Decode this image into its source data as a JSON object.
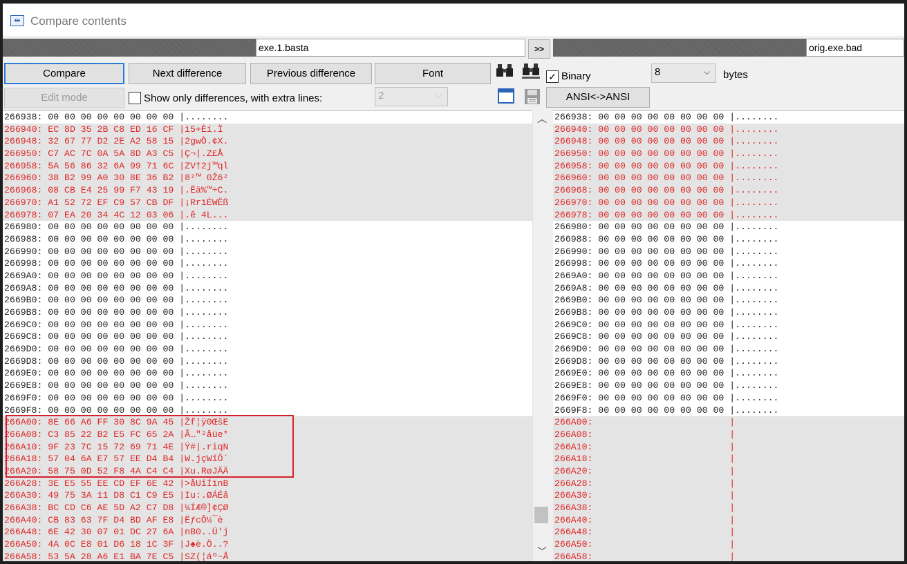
{
  "window": {
    "title": "Compare contents",
    "icon": "compare-icon"
  },
  "files": {
    "left": "exe.1.basta",
    "swap_label": ">>",
    "right": "orig.exe.bad"
  },
  "toolbar": {
    "compare": "Compare",
    "next_diff": "Next difference",
    "prev_diff": "Previous difference",
    "font": "Font",
    "binary_checkbox_mark": "✓",
    "binary_label": "Binary",
    "bytes_value": "8",
    "bytes_label": "bytes",
    "edit_mode": "Edit mode",
    "show_only_label": "Show only differences, with extra lines:",
    "extra_lines_value": "2",
    "ansi": "ANSI<->ANSI",
    "find_icon": "binoculars-icon",
    "find_next_icon": "binoculars-next-icon",
    "window_icon": "window-icon",
    "save_icon": "save-icon"
  },
  "colors": {
    "diff_text": "#e02626",
    "diff_bg": "#e4e4e4",
    "highlight_box": "#d51f2b"
  },
  "left_pane": {
    "rows": [
      {
        "t": "266938: 00 00 00 00 00 00 00 00 |........",
        "d": false
      },
      {
        "t": "266940: EC 8D 35 2B C8 ED 16 CF |ì5+Èí.Ï",
        "d": true
      },
      {
        "t": "266948: 32 67 77 D2 2E A2 58 15 |2gwÒ.¢X.",
        "d": true
      },
      {
        "t": "266950: C7 AC 7C 0A 5A 8D A3 C5 |Ç¬|.Z£Å",
        "d": true
      },
      {
        "t": "266958: 5A 56 86 32 6A 99 71 6C |ZV†2j™ql",
        "d": true
      },
      {
        "t": "266960: 38 B2 99 A0 30 8E 36 B2 |8²™ 0Ž6²",
        "d": true
      },
      {
        "t": "266968: 08 CB E4 25 99 F7 43 19 |.Ëä%™÷C.",
        "d": true
      },
      {
        "t": "266970: A1 52 72 EF C9 57 CB DF |¡RrïÉWËß",
        "d": true
      },
      {
        "t": "266978: 07 EA 20 34 4C 12 03 06 |.ê 4L...",
        "d": true
      },
      {
        "t": "266980: 00 00 00 00 00 00 00 00 |........",
        "d": false
      },
      {
        "t": "266988: 00 00 00 00 00 00 00 00 |........",
        "d": false
      },
      {
        "t": "266990: 00 00 00 00 00 00 00 00 |........",
        "d": false
      },
      {
        "t": "266998: 00 00 00 00 00 00 00 00 |........",
        "d": false
      },
      {
        "t": "2669A0: 00 00 00 00 00 00 00 00 |........",
        "d": false
      },
      {
        "t": "2669A8: 00 00 00 00 00 00 00 00 |........",
        "d": false
      },
      {
        "t": "2669B0: 00 00 00 00 00 00 00 00 |........",
        "d": false
      },
      {
        "t": "2669B8: 00 00 00 00 00 00 00 00 |........",
        "d": false
      },
      {
        "t": "2669C0: 00 00 00 00 00 00 00 00 |........",
        "d": false
      },
      {
        "t": "2669C8: 00 00 00 00 00 00 00 00 |........",
        "d": false
      },
      {
        "t": "2669D0: 00 00 00 00 00 00 00 00 |........",
        "d": false
      },
      {
        "t": "2669D8: 00 00 00 00 00 00 00 00 |........",
        "d": false
      },
      {
        "t": "2669E0: 00 00 00 00 00 00 00 00 |........",
        "d": false
      },
      {
        "t": "2669E8: 00 00 00 00 00 00 00 00 |........",
        "d": false
      },
      {
        "t": "2669F0: 00 00 00 00 00 00 00 00 |........",
        "d": false
      },
      {
        "t": "2669F8: 00 00 00 00 00 00 00 00 |........",
        "d": false
      },
      {
        "t": "266A00: 8E 66 A6 FF 30 8C 9A 45 |Žf¦ÿ0ŒšE",
        "d": true
      },
      {
        "t": "266A08: C3 85 22 B2 E5 FC 65 2A |Ã…\"²åüe*",
        "d": true
      },
      {
        "t": "266A10: 9F 23 7C 15 72 69 71 4E |Ÿ#|.riqN",
        "d": true
      },
      {
        "t": "266A18: 57 04 6A E7 57 EE D4 B4 |W.jçWîÔ´",
        "d": true
      },
      {
        "t": "266A20: 58 75 0D 52 F8 4A C4 C4 |Xu.RøJÄÄ",
        "d": true
      },
      {
        "t": "266A28: 3E E5 55 EE CD EF 6E 42 |>åUîÍïnB",
        "d": true
      },
      {
        "t": "266A30: 49 75 3A 11 D8 C1 C9 E5 |Iu:.ØÁÉå",
        "d": true
      },
      {
        "t": "266A38: BC CD C6 AE 5D A2 C7 D8 |¼ÍÆ®]¢ÇØ",
        "d": true
      },
      {
        "t": "266A40: CB 83 63 7F D4 BD AF E8 |ËƒcÔ½¯è",
        "d": true
      },
      {
        "t": "266A48: 6E 42 30 07 01 DC 27 6A |nB0..Ü'j",
        "d": true
      },
      {
        "t": "266A50: 4A 0C E8 01 D6 18 1C 3F |J♠è.Ö..?",
        "d": true
      },
      {
        "t": "266A58: 53 5A 28 A6 E1 BA 7E C5 |SZ(¦áº~Å",
        "d": true
      }
    ]
  },
  "right_pane": {
    "rows": [
      {
        "t": "266938: 00 00 00 00 00 00 00 00 |........",
        "d": false
      },
      {
        "t": "266940: 00 00 00 00 00 00 00 00 |........",
        "d": true
      },
      {
        "t": "266948: 00 00 00 00 00 00 00 00 |........",
        "d": true
      },
      {
        "t": "266950: 00 00 00 00 00 00 00 00 |........",
        "d": true
      },
      {
        "t": "266958: 00 00 00 00 00 00 00 00 |........",
        "d": true
      },
      {
        "t": "266960: 00 00 00 00 00 00 00 00 |........",
        "d": true
      },
      {
        "t": "266968: 00 00 00 00 00 00 00 00 |........",
        "d": true
      },
      {
        "t": "266970: 00 00 00 00 00 00 00 00 |........",
        "d": true
      },
      {
        "t": "266978: 00 00 00 00 00 00 00 00 |........",
        "d": true
      },
      {
        "t": "266980: 00 00 00 00 00 00 00 00 |........",
        "d": false
      },
      {
        "t": "266988: 00 00 00 00 00 00 00 00 |........",
        "d": false
      },
      {
        "t": "266990: 00 00 00 00 00 00 00 00 |........",
        "d": false
      },
      {
        "t": "266998: 00 00 00 00 00 00 00 00 |........",
        "d": false
      },
      {
        "t": "2669A0: 00 00 00 00 00 00 00 00 |........",
        "d": false
      },
      {
        "t": "2669A8: 00 00 00 00 00 00 00 00 |........",
        "d": false
      },
      {
        "t": "2669B0: 00 00 00 00 00 00 00 00 |........",
        "d": false
      },
      {
        "t": "2669B8: 00 00 00 00 00 00 00 00 |........",
        "d": false
      },
      {
        "t": "2669C0: 00 00 00 00 00 00 00 00 |........",
        "d": false
      },
      {
        "t": "2669C8: 00 00 00 00 00 00 00 00 |........",
        "d": false
      },
      {
        "t": "2669D0: 00 00 00 00 00 00 00 00 |........",
        "d": false
      },
      {
        "t": "2669D8: 00 00 00 00 00 00 00 00 |........",
        "d": false
      },
      {
        "t": "2669E0: 00 00 00 00 00 00 00 00 |........",
        "d": false
      },
      {
        "t": "2669E8: 00 00 00 00 00 00 00 00 |........",
        "d": false
      },
      {
        "t": "2669F0: 00 00 00 00 00 00 00 00 |........",
        "d": false
      },
      {
        "t": "2669F8: 00 00 00 00 00 00 00 00 |........",
        "d": false
      },
      {
        "t": "266A00:                         |",
        "d": true
      },
      {
        "t": "266A08:                         |",
        "d": true
      },
      {
        "t": "266A10:                         |",
        "d": true
      },
      {
        "t": "266A18:                         |",
        "d": true
      },
      {
        "t": "266A20:                         |",
        "d": true
      },
      {
        "t": "266A28:                         |",
        "d": true
      },
      {
        "t": "266A30:                         |",
        "d": true
      },
      {
        "t": "266A38:                         |",
        "d": true
      },
      {
        "t": "266A40:                         |",
        "d": true
      },
      {
        "t": "266A48:                         |",
        "d": true
      },
      {
        "t": "266A50:                         |",
        "d": true
      },
      {
        "t": "266A58:                         |",
        "d": true
      }
    ]
  },
  "scrollbar": {
    "position": 0.94
  }
}
